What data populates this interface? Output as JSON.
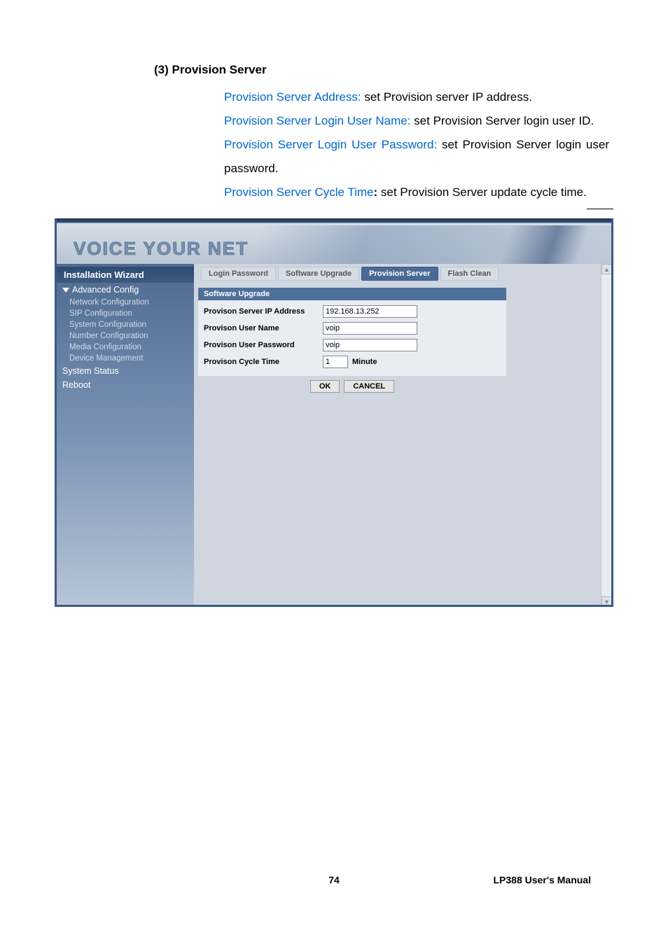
{
  "section": {
    "heading": "(3) Provision Server",
    "items": [
      {
        "label": "Provision Server Address: ",
        "text": "set Provision server IP address."
      },
      {
        "label": "Provision Server Login User Name:",
        "text": " set Provision Server login user ID."
      },
      {
        "label": "Provision Server Login User Password:",
        "text": " set Provision Server login user password."
      },
      {
        "label": "Provision Server Cycle Time",
        "bold_colon": ":",
        "text": " set Provision Server update cycle time."
      }
    ]
  },
  "banner_text": "VOICE YOUR NET",
  "sidebar": {
    "header": "Installation Wizard",
    "group": "Advanced Config",
    "items": [
      "Network Configuration",
      "SIP Configuration",
      "System Configuration",
      "Number Configuration",
      "Media Configuration",
      "Device Management"
    ],
    "status": "System Status",
    "reboot": "Reboot"
  },
  "tabs": [
    {
      "label": "Login Password",
      "active": false
    },
    {
      "label": "Software Upgrade",
      "active": false
    },
    {
      "label": "Provision Server",
      "active": true
    },
    {
      "label": "Flash Clean",
      "active": false
    }
  ],
  "form": {
    "title": "Software Upgrade",
    "rows": {
      "ip_label": "Provison Server IP Address",
      "ip_value": "192.168.13.252",
      "user_label": "Provison User Name",
      "user_value": "voip",
      "pw_label": "Provison User Password",
      "pw_value": "voip",
      "cycle_label": "Provison Cycle Time",
      "cycle_value": "1",
      "cycle_unit": "Minute"
    },
    "ok": "OK",
    "cancel": "CANCEL"
  },
  "footer": {
    "page": "74",
    "manual": "LP388  User's  Manual"
  }
}
